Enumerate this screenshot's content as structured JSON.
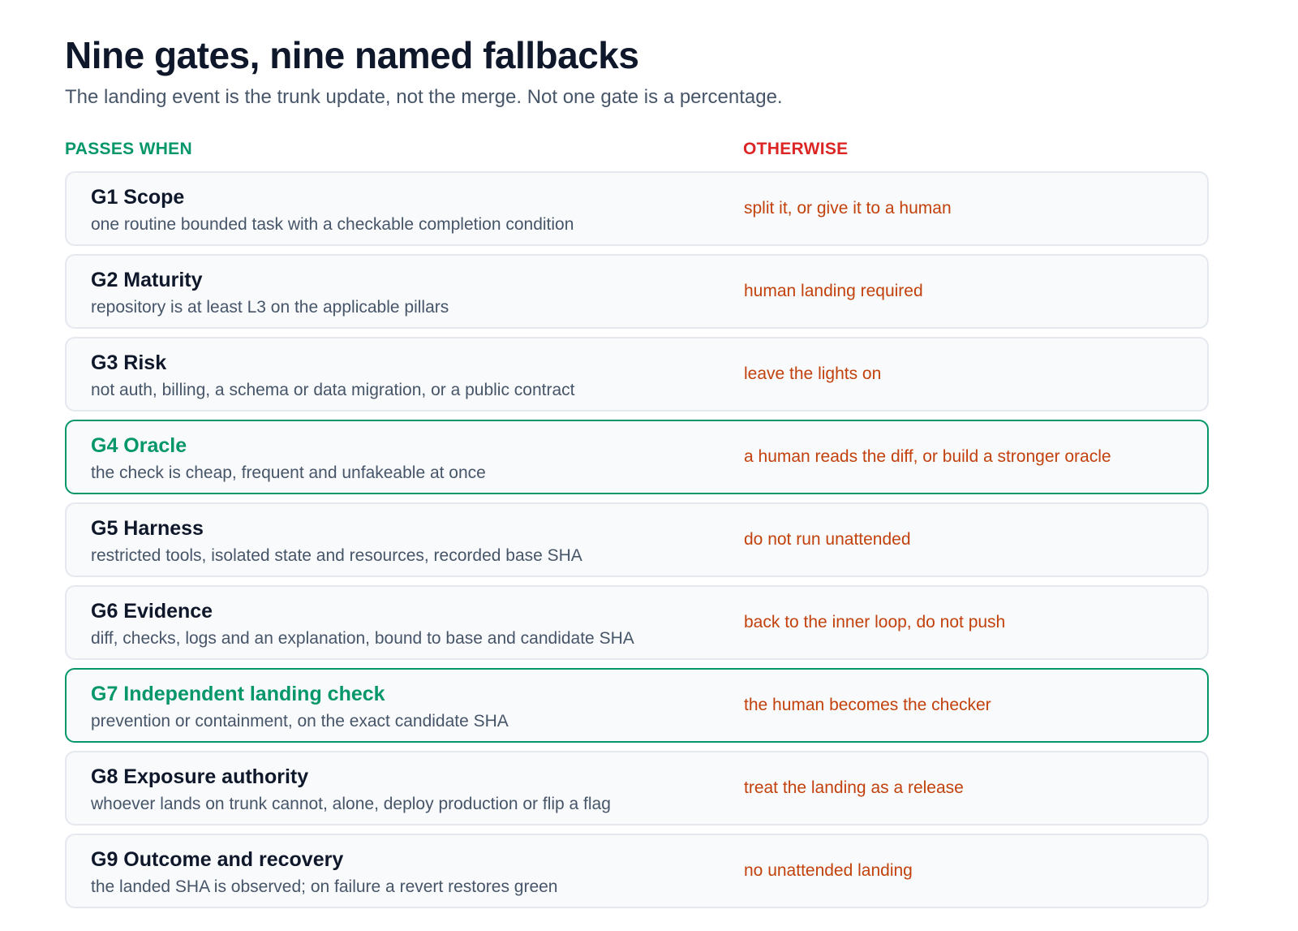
{
  "header": {
    "title": "Nine gates, nine named fallbacks",
    "subtitle": "The landing event is the trunk update, not the merge. Not one gate is a percentage."
  },
  "columns": {
    "passes_when": "PASSES WHEN",
    "otherwise": "OTHERWISE"
  },
  "colors": {
    "pass_accent": "#059669",
    "otherwise_accent": "#dc2626",
    "fallback_text": "#c2410c",
    "row_background": "#f8fafc",
    "row_border": "#e5e9ef"
  },
  "gates": [
    {
      "title": "G1 Scope",
      "condition": "one routine bounded task with a checkable completion condition",
      "fallback": "split it, or give it to a human",
      "highlighted": false
    },
    {
      "title": "G2 Maturity",
      "condition": "repository is at least L3 on the applicable pillars",
      "fallback": "human landing required",
      "highlighted": false
    },
    {
      "title": "G3 Risk",
      "condition": "not auth, billing, a schema or data migration, or a public contract",
      "fallback": "leave the lights on",
      "highlighted": false
    },
    {
      "title": "G4 Oracle",
      "condition": "the check is cheap, frequent and unfakeable at once",
      "fallback": "a human reads the diff, or build a stronger oracle",
      "highlighted": true
    },
    {
      "title": "G5 Harness",
      "condition": "restricted tools, isolated state and resources, recorded base SHA",
      "fallback": "do not run unattended",
      "highlighted": false
    },
    {
      "title": "G6 Evidence",
      "condition": "diff, checks, logs and an explanation, bound to base and candidate SHA",
      "fallback": "back to the inner loop, do not push",
      "highlighted": false
    },
    {
      "title": "G7 Independent landing check",
      "condition": "prevention or containment, on the exact candidate SHA",
      "fallback": "the human becomes the checker",
      "highlighted": true
    },
    {
      "title": "G8 Exposure authority",
      "condition": "whoever lands on trunk cannot, alone, deploy production or flip a flag",
      "fallback": "treat the landing as a release",
      "highlighted": false
    },
    {
      "title": "G9 Outcome and recovery",
      "condition": "the landed SHA is observed; on failure a revert restores green",
      "fallback": "no unattended landing",
      "highlighted": false
    }
  ]
}
